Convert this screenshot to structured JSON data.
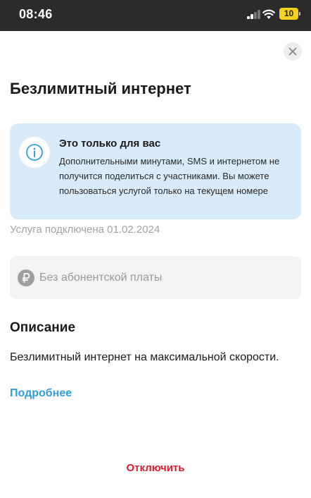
{
  "status_bar": {
    "time": "08:46",
    "battery_level": "10",
    "battery_color": "#f2d21b"
  },
  "header": {
    "close_icon": "close-icon"
  },
  "page": {
    "title": "Безлимитный интернет"
  },
  "info_card": {
    "icon": "info-icon",
    "title": "Это только для вас",
    "text": "Дополнительными минутами, SMS и интернетом не получится поделиться с участниками. Вы можете пользоваться услугой только на текущем номере",
    "background": "#d8ebfb"
  },
  "service": {
    "status_text": "Услуга подключена 01.02.2024"
  },
  "fee": {
    "icon": "ruble-icon",
    "label": "Без абонентской платы"
  },
  "description": {
    "heading": "Описание",
    "text": "Безлимитный интернет на максимальной скорости.",
    "more_link": "Подробнее"
  },
  "actions": {
    "disable_label": "Отключить",
    "disable_color": "#e0182d",
    "link_color": "#2d9fde"
  }
}
